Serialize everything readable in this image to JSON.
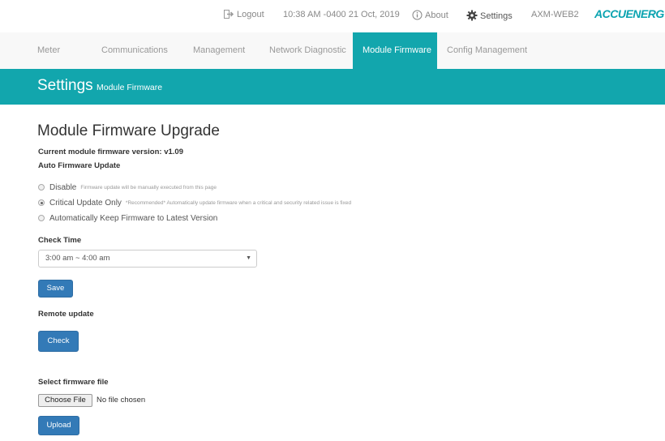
{
  "topbar": {
    "logout": "Logout",
    "datetime": "10:38 AM -0400 21 Oct, 2019",
    "about": "About",
    "settings": "Settings",
    "device": "AXM-WEB2",
    "logo": "ACCUENERGY"
  },
  "nav": {
    "tabs": [
      "Meter",
      "Communications",
      "Management",
      "Network Diagnostic",
      "Module Firmware",
      "Config Management"
    ],
    "active": "Module Firmware"
  },
  "band": {
    "title": "Settings",
    "subtitle": "Module Firmware"
  },
  "main": {
    "heading": "Module Firmware Upgrade",
    "current_version": "Current module firmware version: v1.09",
    "auto_label": "Auto Firmware Update",
    "options": [
      {
        "label": "Disable",
        "desc": "Firmware update will be manually executed from this page",
        "selected": false
      },
      {
        "label": "Critical Update Only",
        "desc": "*Recommended* Automatically update firmware when a critical and security related issue is fixed",
        "selected": true
      },
      {
        "label": "Automatically Keep Firmware to Latest Version",
        "desc": "",
        "selected": false
      }
    ],
    "check_time_label": "Check Time",
    "check_time_value": "3:00 am ~ 4:00 am",
    "save": "Save",
    "remote_label": "Remote update",
    "check": "Check",
    "select_file_label": "Select firmware file",
    "choose_file": "Choose File",
    "no_file": "No file chosen",
    "upload": "Upload"
  },
  "colors": {
    "accent": "#12a6ad",
    "button": "#337ab7"
  }
}
